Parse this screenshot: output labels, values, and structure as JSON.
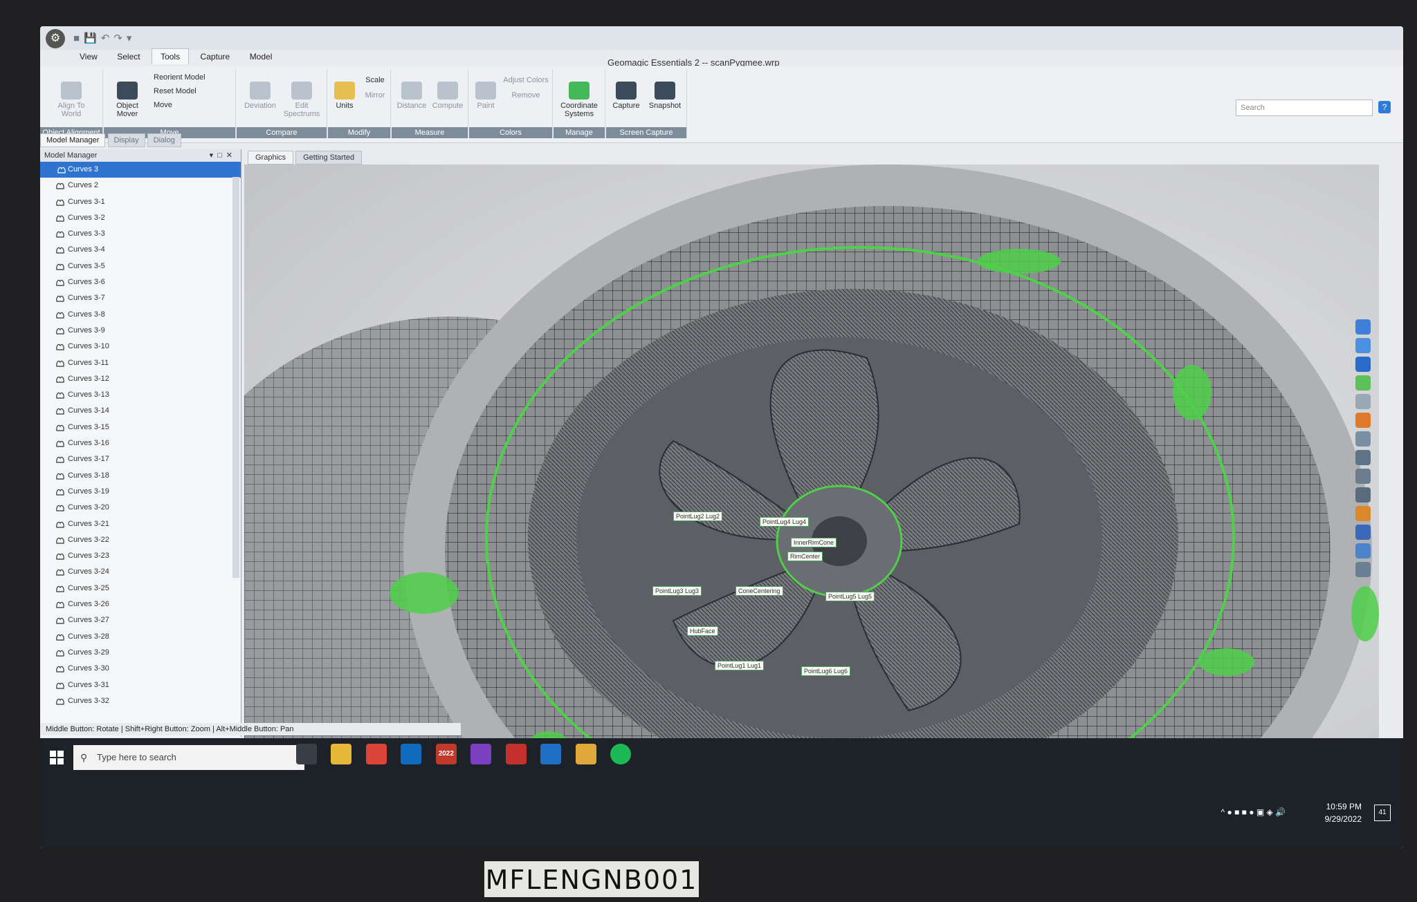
{
  "window": {
    "title": "Geomagic Essentials 2 -- scanPygmee.wrp",
    "app_icon": "geomagic-logo-icon"
  },
  "menu_tabs": [
    "View",
    "Select",
    "Tools",
    "Capture",
    "Model"
  ],
  "active_menu_tab": "Tools",
  "ribbon": {
    "object_alignment": {
      "label": "Object Alignment",
      "align": "Align To World"
    },
    "move": {
      "label": "Move",
      "object_mover": "Object Mover",
      "reorient": "Reorient Model",
      "reset": "Reset Model",
      "move": "Move"
    },
    "compare": {
      "label": "Compare",
      "deviation": "Deviation",
      "edit_spectrums": "Edit Spectrums"
    },
    "modify": {
      "label": "Modify",
      "units": "Units",
      "scale": "Scale",
      "mirror": "Mirror"
    },
    "measure": {
      "label": "Measure",
      "distance": "Distance",
      "compute": "Compute"
    },
    "colors": {
      "label": "Colors",
      "paint": "Paint",
      "adjust": "Adjust Colors",
      "remove": "Remove"
    },
    "manage": {
      "label": "Manage",
      "coordinate_systems": "Coordinate Systems"
    },
    "screen_capture": {
      "label": "Screen Capture",
      "capture": "Capture",
      "snapshot": "Snapshot"
    }
  },
  "search": {
    "placeholder": "Search"
  },
  "panel_tabs": [
    "Model Manager",
    "Display",
    "Dialog"
  ],
  "model_manager": {
    "title": "Model Manager",
    "items": [
      "Curves 3",
      "Curves 2",
      "Curves 3-1",
      "Curves 3-2",
      "Curves 3-3",
      "Curves 3-4",
      "Curves 3-5",
      "Curves 3-6",
      "Curves 3-7",
      "Curves 3-8",
      "Curves 3-9",
      "Curves 3-10",
      "Curves 3-11",
      "Curves 3-12",
      "Curves 3-13",
      "Curves 3-14",
      "Curves 3-15",
      "Curves 3-16",
      "Curves 3-17",
      "Curves 3-18",
      "Curves 3-19",
      "Curves 3-20",
      "Curves 3-21",
      "Curves 3-22",
      "Curves 3-23",
      "Curves 3-24",
      "Curves 3-25",
      "Curves 3-26",
      "Curves 3-27",
      "Curves 3-28",
      "Curves 3-29",
      "Curves 3-30",
      "Curves 3-31",
      "Curves 3-32"
    ],
    "selected": "Curves 3"
  },
  "doc_tabs": [
    "Graphics",
    "Getting Started"
  ],
  "viewport_labels": [
    "PointLug2 Lug2",
    "PointLug4 Lug4",
    "InnerRimCone",
    "RimCenter",
    "PointLug5 Lug5",
    "ConeCentering",
    "PointLug3 Lug3",
    "HubFace",
    "PointLug1 Lug1",
    "PointLug6 Lug6"
  ],
  "status_bar": "Middle Button: Rotate | Shift+Right Button: Zoom | Alt+Middle Button: Pan",
  "taskbar": {
    "search_placeholder": "Type here to search",
    "time": "10:59 PM",
    "date": "9/29/2022",
    "notification_count": "41",
    "app_badge": "2022"
  },
  "sticker": "MFLENGNB001",
  "colors": {
    "accent": "#2f74d0",
    "scan_green": "#4fd04a",
    "ribbon_label": "#7e8c9a"
  }
}
